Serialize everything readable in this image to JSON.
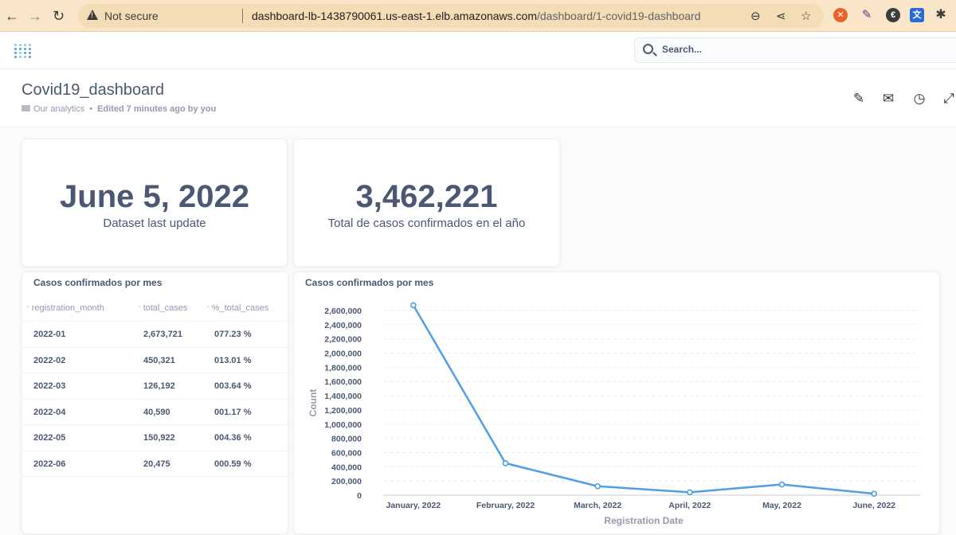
{
  "browser": {
    "security_label": "Not secure",
    "url_host": "dashboard-lb-1438790061.us-east-1.elb.amazonaws.com",
    "url_path": "/dashboard/1-covid19-dashboard"
  },
  "search": {
    "placeholder": "Search..."
  },
  "dashboard": {
    "title": "Covid19_dashboard",
    "collection": "Our analytics",
    "edited": "Edited 7 minutes ago by you"
  },
  "cards": {
    "last_update": {
      "value": "June 5, 2022",
      "label": "Dataset last update"
    },
    "total_cases": {
      "value": "3,462,221",
      "label": "Total de casos confirmados en el año"
    }
  },
  "table": {
    "title": "Casos confirmados por mes",
    "columns": [
      "registration_month",
      "total_cases",
      "%_total_cases"
    ],
    "rows": [
      [
        "2022-01",
        "2,673,721",
        "077.23 %"
      ],
      [
        "2022-02",
        "450,321",
        "013.01 %"
      ],
      [
        "2022-03",
        "126,192",
        "003.64 %"
      ],
      [
        "2022-04",
        "40,590",
        "001.17 %"
      ],
      [
        "2022-05",
        "150,922",
        "004.36 %"
      ],
      [
        "2022-06",
        "20,475",
        "000.59 %"
      ]
    ]
  },
  "chart_data": {
    "type": "line",
    "title": "Casos confirmados por mes",
    "xlabel": "Registration Date",
    "ylabel": "Count",
    "categories": [
      "January, 2022",
      "February, 2022",
      "March, 2022",
      "April, 2022",
      "May, 2022",
      "June, 2022"
    ],
    "series": [
      {
        "values": [
          2673721,
          450321,
          126192,
          40590,
          150922,
          20475
        ]
      }
    ],
    "ylim": [
      0,
      2600000
    ],
    "yticks": [
      0,
      200000,
      400000,
      600000,
      800000,
      1000000,
      1200000,
      1400000,
      1600000,
      1800000,
      2000000,
      2200000,
      2400000,
      2600000
    ],
    "grid": true,
    "line_color": "#509ee3"
  }
}
